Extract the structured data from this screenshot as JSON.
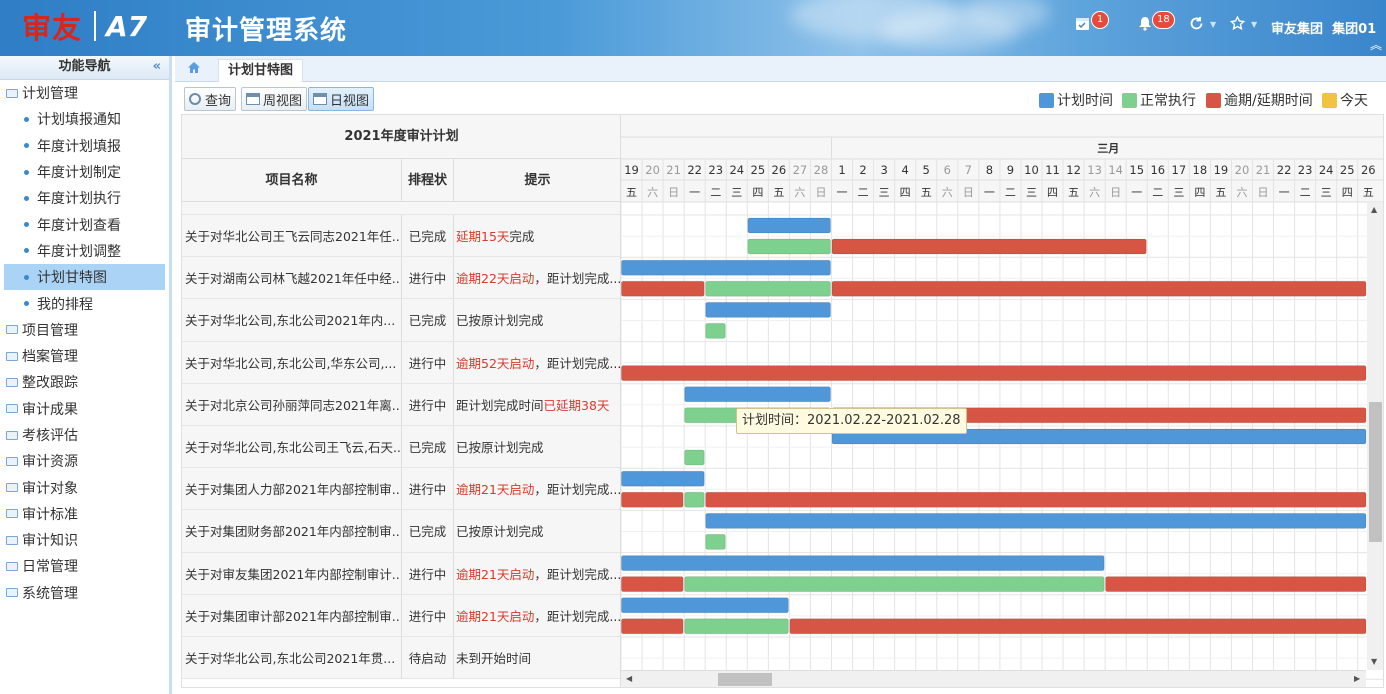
{
  "header": {
    "brand": "审友",
    "version": "A7",
    "system_name": "审计管理系统",
    "calendar_badge": "1",
    "bell_badge": "18",
    "org": "审友集团",
    "unit": "集团01"
  },
  "sidebar": {
    "title": "功能导航",
    "groups": [
      {
        "label": "计划管理",
        "children": [
          "计划填报通知",
          "年度计划填报",
          "年度计划制定",
          "年度计划执行",
          "年度计划查看",
          "年度计划调整",
          "计划甘特图",
          "我的排程"
        ],
        "active": "计划甘特图"
      },
      {
        "label": "项目管理"
      },
      {
        "label": "档案管理"
      },
      {
        "label": "整改跟踪"
      },
      {
        "label": "审计成果"
      },
      {
        "label": "考核评估"
      },
      {
        "label": "审计资源"
      },
      {
        "label": "审计对象"
      },
      {
        "label": "审计标准"
      },
      {
        "label": "审计知识"
      },
      {
        "label": "日常管理"
      },
      {
        "label": "系统管理"
      }
    ]
  },
  "tabs": {
    "active": "计划甘特图"
  },
  "toolbar": {
    "query": "查询",
    "week_view": "周视图",
    "day_view": "日视图"
  },
  "legend": [
    {
      "label": "计划时间",
      "color": "#4f97d8"
    },
    {
      "label": "正常执行",
      "color": "#7ed08e"
    },
    {
      "label": "逾期/延期时间",
      "color": "#d75545"
    },
    {
      "label": "今天",
      "color": "#f2c241"
    }
  ],
  "table": {
    "title": "2021年度审计计划",
    "columns": [
      "项目名称",
      "排程状态",
      "提示"
    ],
    "rows": [
      {
        "name": "关于对华北公司王飞云同志2021年任...",
        "status": "已完成",
        "hint_red": "延期15天",
        "hint": "完成"
      },
      {
        "name": "关于对湖南公司林飞越2021年任中经...",
        "status": "进行中",
        "hint_red": "逾期22天启动",
        "hint": "，距计划完成..."
      },
      {
        "name": "关于对华北公司,东北公司2021年内...",
        "status": "已完成",
        "hint_red": "",
        "hint": "已按原计划完成"
      },
      {
        "name": "关于对华北公司,东北公司,华东公司,...",
        "status": "进行中",
        "hint_red": "逾期52天启动",
        "hint": "，距计划完成..."
      },
      {
        "name": "关于对北京公司孙丽萍同志2021年离...",
        "status": "进行中",
        "hint_pre": "距计划完成时间",
        "hint_red": "已延期38天",
        "hint": ""
      },
      {
        "name": "关于对华北公司,东北公司王飞云,石天...",
        "status": "已完成",
        "hint_red": "",
        "hint": "已按原计划完成"
      },
      {
        "name": "关于对集团人力部2021年内部控制审...",
        "status": "进行中",
        "hint_red": "逾期21天启动",
        "hint": "，距计划完成..."
      },
      {
        "name": "关于对集团财务部2021年内部控制审...",
        "status": "已完成",
        "hint_red": "",
        "hint": "已按原计划完成"
      },
      {
        "name": "关于对审友集团2021年内部控制审计...",
        "status": "进行中",
        "hint_red": "逾期21天启动",
        "hint": "，距计划完成..."
      },
      {
        "name": "关于对集团审计部2021年内部控制审...",
        "status": "进行中",
        "hint_red": "逾期21天启动",
        "hint": "，距计划完成..."
      },
      {
        "name": "关于对华北公司,东北公司2021年贯...",
        "status": "待启动",
        "hint_red": "",
        "hint": "未到开始时间"
      }
    ]
  },
  "gantt": {
    "month_label": "三月",
    "days": [
      "19",
      "20",
      "21",
      "22",
      "23",
      "24",
      "25",
      "26",
      "27",
      "28",
      "1",
      "2",
      "3",
      "4",
      "5",
      "6",
      "7",
      "8",
      "9",
      "10",
      "11",
      "12",
      "13",
      "14",
      "15",
      "16",
      "17",
      "18",
      "19",
      "20",
      "21",
      "22",
      "23",
      "24",
      "25",
      "26"
    ],
    "weekdays": [
      "五",
      "六",
      "日",
      "一",
      "二",
      "三",
      "四",
      "五",
      "六",
      "日",
      "一",
      "二",
      "三",
      "四",
      "五",
      "六",
      "日",
      "一",
      "二",
      "三",
      "四",
      "五",
      "六",
      "日",
      "一",
      "二",
      "三",
      "四",
      "五",
      "六",
      "日",
      "一",
      "二",
      "三",
      "四",
      "五"
    ],
    "weekend_index": [
      1,
      2,
      8,
      9,
      15,
      16,
      22,
      23,
      29,
      30
    ],
    "bars": [
      {
        "row": 0,
        "lane": 0,
        "type": "plan",
        "start": 6,
        "end": 10
      },
      {
        "row": 0,
        "lane": 1,
        "type": "normal",
        "start": 6,
        "end": 10
      },
      {
        "row": 0,
        "lane": 1,
        "type": "overdue",
        "start": 10,
        "end": 25
      },
      {
        "row": 1,
        "lane": 0,
        "type": "plan",
        "start": 0,
        "end": 10
      },
      {
        "row": 1,
        "lane": 1,
        "type": "overdue",
        "start": 0,
        "end": 4
      },
      {
        "row": 1,
        "lane": 1,
        "type": "normal",
        "start": 4,
        "end": 10
      },
      {
        "row": 1,
        "lane": 1,
        "type": "overdue",
        "start": 10,
        "end": 36
      },
      {
        "row": 2,
        "lane": 0,
        "type": "plan",
        "start": 4,
        "end": 10
      },
      {
        "row": 2,
        "lane": 1,
        "type": "normal",
        "start": 4,
        "end": 5
      },
      {
        "row": 3,
        "lane": 1,
        "type": "overdue",
        "start": 0,
        "end": 36
      },
      {
        "row": 4,
        "lane": 0,
        "type": "plan",
        "start": 3,
        "end": 10
      },
      {
        "row": 4,
        "lane": 1,
        "type": "normal",
        "start": 3,
        "end": 10
      },
      {
        "row": 4,
        "lane": 1,
        "type": "overdue",
        "start": 10,
        "end": 36
      },
      {
        "row": 5,
        "lane": 0,
        "type": "plan",
        "start": 10,
        "end": 36
      },
      {
        "row": 5,
        "lane": 1,
        "type": "normal",
        "start": 3,
        "end": 4
      },
      {
        "row": 6,
        "lane": 0,
        "type": "plan",
        "start": 0,
        "end": 4
      },
      {
        "row": 6,
        "lane": 1,
        "type": "overdue",
        "start": 0,
        "end": 3
      },
      {
        "row": 6,
        "lane": 1,
        "type": "normal",
        "start": 3,
        "end": 4
      },
      {
        "row": 6,
        "lane": 1,
        "type": "overdue",
        "start": 4,
        "end": 36
      },
      {
        "row": 7,
        "lane": 0,
        "type": "plan",
        "start": 4,
        "end": 36
      },
      {
        "row": 7,
        "lane": 1,
        "type": "normal",
        "start": 4,
        "end": 5
      },
      {
        "row": 8,
        "lane": 0,
        "type": "plan",
        "start": 0,
        "end": 23
      },
      {
        "row": 8,
        "lane": 1,
        "type": "overdue",
        "start": 0,
        "end": 3
      },
      {
        "row": 8,
        "lane": 1,
        "type": "normal",
        "start": 3,
        "end": 23
      },
      {
        "row": 8,
        "lane": 1,
        "type": "overdue",
        "start": 23,
        "end": 36
      },
      {
        "row": 9,
        "lane": 0,
        "type": "plan",
        "start": 0,
        "end": 8
      },
      {
        "row": 9,
        "lane": 1,
        "type": "overdue",
        "start": 0,
        "end": 3
      },
      {
        "row": 9,
        "lane": 1,
        "type": "normal",
        "start": 3,
        "end": 8
      },
      {
        "row": 9,
        "lane": 1,
        "type": "overdue",
        "start": 8,
        "end": 36
      }
    ],
    "tooltip": "计划时间：2021.02.22-2021.02.28"
  }
}
